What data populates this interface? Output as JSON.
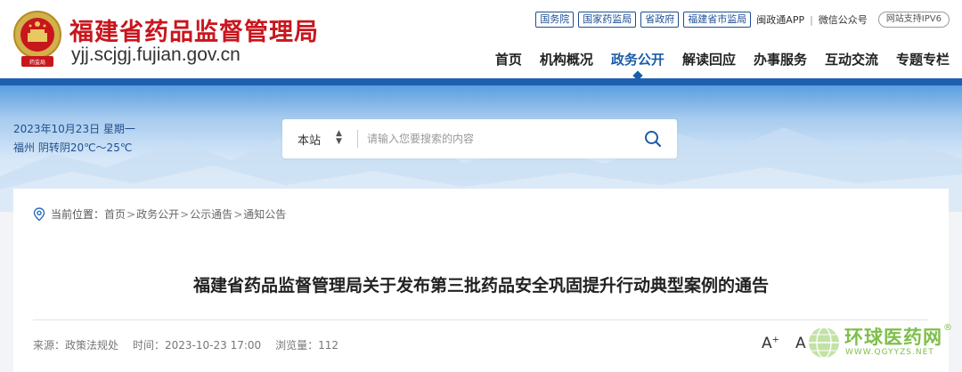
{
  "header": {
    "site_name": "福建省药品监督管理局",
    "site_url": "yjj.scjgj.fujian.gov.cn",
    "top_links": [
      "国务院",
      "国家药监局",
      "省政府",
      "福建省市监局"
    ],
    "app_link": "闽政通APP",
    "wechat_link": "微信公众号",
    "ipv6_badge": "网站支持IPV6",
    "nav": [
      {
        "label": "首页",
        "active": false
      },
      {
        "label": "机构概况",
        "active": false
      },
      {
        "label": "政务公开",
        "active": true
      },
      {
        "label": "解读回应",
        "active": false
      },
      {
        "label": "办事服务",
        "active": false
      },
      {
        "label": "互动交流",
        "active": false
      },
      {
        "label": "专题专栏",
        "active": false
      }
    ]
  },
  "banner": {
    "date": "2023年10月23日 星期一",
    "weather": "福州 阴转阴20℃～25℃"
  },
  "search": {
    "scope": "本站",
    "placeholder": "请输入您要搜索的内容"
  },
  "breadcrumb": {
    "label": "当前位置：",
    "items": [
      "首页",
      "政务公开",
      "公示通告",
      "通知公告"
    ],
    "separator": ">"
  },
  "article": {
    "title": "福建省药品监督管理局关于发布第三批药品安全巩固提升行动典型案例的通告",
    "source": "来源：政策法规处",
    "time": "时间：2023-10-23 17:00",
    "views": "浏览量：112"
  },
  "font_controls": {
    "large": "A",
    "large_sign": "+",
    "small": "A"
  },
  "watermark": {
    "title": "环球医药网",
    "reg": "®",
    "url": "WWW.QGYYZS.NET"
  },
  "colors": {
    "brand_red": "#c8161d",
    "nav_active": "#1d5da7",
    "link_blue": "#1d4e95",
    "watermark_green": "#7ebf4a"
  }
}
